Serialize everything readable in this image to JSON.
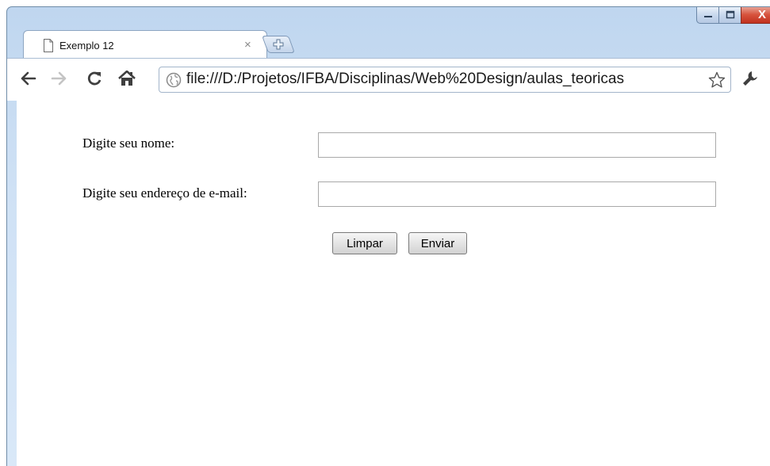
{
  "window": {
    "controls": {
      "minimize": "–",
      "maximize": "□",
      "close": "X"
    }
  },
  "tab": {
    "title": "Exemplo 12",
    "close": "×",
    "icon": "page-icon"
  },
  "toolbar": {
    "url": "file:///D:/Projetos/IFBA/Disciplinas/Web%20Design/aulas_teoricas",
    "icons": [
      "back-arrow-icon",
      "forward-arrow-icon",
      "reload-icon",
      "home-icon",
      "globe-icon",
      "star-icon",
      "wrench-icon"
    ]
  },
  "form": {
    "name_label": "Digite seu nome:",
    "name_value": "",
    "email_label": "Digite seu endereço de e-mail:",
    "email_value": "",
    "reset_label": "Limpar",
    "submit_label": "Enviar"
  },
  "colors": {
    "frame": "#cfe1f5",
    "close_button": "#d7533d",
    "nav_icon": "#4a4a4a"
  }
}
